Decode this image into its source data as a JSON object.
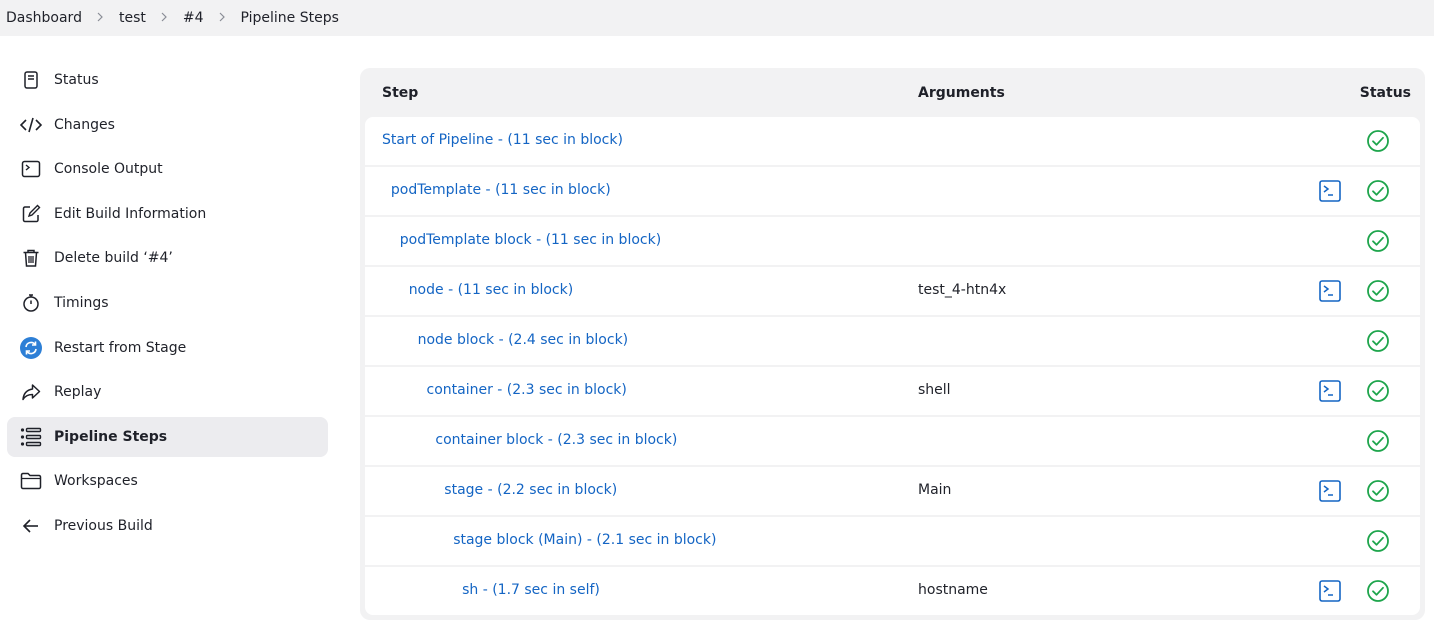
{
  "breadcrumb": [
    "Dashboard",
    "test",
    "#4",
    "Pipeline Steps"
  ],
  "sidebar": {
    "items": [
      {
        "label": "Status",
        "icon": "document-icon"
      },
      {
        "label": "Changes",
        "icon": "code-icon"
      },
      {
        "label": "Console Output",
        "icon": "terminal-icon"
      },
      {
        "label": "Edit Build Information",
        "icon": "edit-icon"
      },
      {
        "label": "Delete build ‘#4’",
        "icon": "trash-icon"
      },
      {
        "label": "Timings",
        "icon": "stopwatch-icon"
      },
      {
        "label": "Restart from Stage",
        "icon": "restart-icon"
      },
      {
        "label": "Replay",
        "icon": "replay-icon"
      },
      {
        "label": "Pipeline Steps",
        "icon": "list-icon",
        "active": true
      },
      {
        "label": "Workspaces",
        "icon": "folder-icon"
      },
      {
        "label": "Previous Build",
        "icon": "arrow-left-icon"
      }
    ]
  },
  "table": {
    "headers": {
      "step": "Step",
      "arguments": "Arguments",
      "status": "Status"
    },
    "rows": [
      {
        "step": "Start of Pipeline - (11 sec in block)",
        "args": "",
        "console": false,
        "status": "success"
      },
      {
        "step": "podTemplate - (11 sec in block)",
        "args": "",
        "console": true,
        "status": "success"
      },
      {
        "step": "podTemplate block - (11 sec in block)",
        "args": "",
        "console": false,
        "status": "success"
      },
      {
        "step": "node - (11 sec in block)",
        "args": "test_4-htn4x",
        "console": true,
        "status": "success"
      },
      {
        "step": "node block - (2.4 sec in block)",
        "args": "",
        "console": false,
        "status": "success"
      },
      {
        "step": "container - (2.3 sec in block)",
        "args": "shell",
        "console": true,
        "status": "success"
      },
      {
        "step": "container block - (2.3 sec in block)",
        "args": "",
        "console": false,
        "status": "success"
      },
      {
        "step": "stage - (2.2 sec in block)",
        "args": "Main",
        "console": true,
        "status": "success"
      },
      {
        "step": "stage block (Main) - (2.1 sec in block)",
        "args": "",
        "console": false,
        "status": "success"
      },
      {
        "step": "sh - (1.7 sec in self)",
        "args": "hostname",
        "console": true,
        "status": "success"
      }
    ]
  },
  "colors": {
    "link": "#1465c4",
    "success": "#1ea54c",
    "console": "#1465c4",
    "panel_bg": "#f2f2f3",
    "active_bg": "#ececef"
  }
}
